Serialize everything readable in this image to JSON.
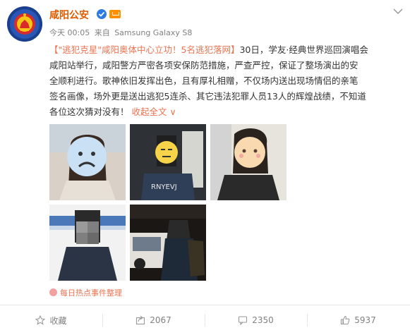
{
  "account": {
    "name": "咸阳公安"
  },
  "meta": {
    "time": "今天 00:05",
    "from_prefix": "来自",
    "device": "Samsung Galaxy S8"
  },
  "post": {
    "hashtag": "【\"逃犯克星\"咸阳奥体中心立功！5名逃犯落网】",
    "line1_rest": "30日，学友·经典世界巡回演唱会",
    "line2": "咸阳站举行，咸阳警方严密各项安保防范措施，严查严控，保证了整场演出的安",
    "line3": "全顺利进行。歌神依旧发挥出色，且有厚礼相赠，不仅场内送出现场情侣的亲笔",
    "line4": "签名画像，场外更是送出逃犯5连杀、其它违法犯罪人员13人的辉煌战绩，不知道",
    "line5": "各位这次猜对没有！",
    "collapse": "收起全文",
    "collapse_arrow": "∨"
  },
  "images": {
    "img5_text": "RNYEVJ"
  },
  "source": {
    "label": "每日热点事件整理"
  },
  "actions": {
    "favorite": "收藏",
    "share_count": "2067",
    "comment_count": "2350",
    "like_count": "5937"
  },
  "colors": {
    "name": "#e05a00",
    "link": "#eb7350",
    "verified": "#ffb400",
    "meta": "#808080"
  },
  "icons": [
    "verified-icon",
    "level-icon",
    "chevron-down-icon",
    "star-icon",
    "share-icon",
    "comment-icon",
    "like-icon"
  ]
}
